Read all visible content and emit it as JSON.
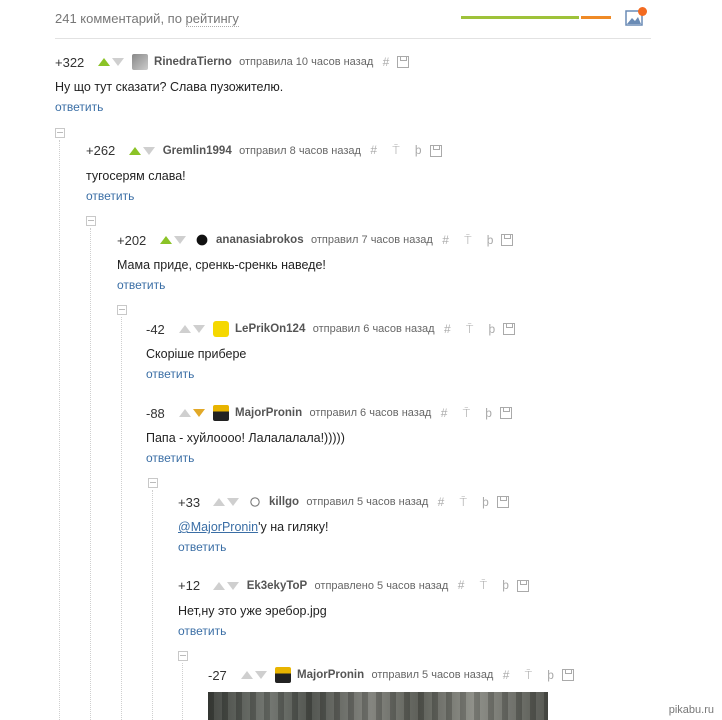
{
  "header": {
    "count_label": "241 комментарий, по ",
    "sort_label": "рейтингу",
    "colors": {
      "accent_green": "#9ec23a",
      "accent_orange": "#ef8a26"
    },
    "icons": [
      "image-icon",
      "notification-dot"
    ]
  },
  "reply_label": "ответить",
  "comments": [
    {
      "rating": "+322",
      "nick": "RinedraTierno",
      "meta": "отправила 10 часов назад",
      "text": "Ну що тут сказати? Слава пузожителю.",
      "vote": "up"
    },
    {
      "rating": "+262",
      "nick": "Gremlin1994",
      "meta": "отправил 8 часов назад",
      "text": "тугосерям слава!",
      "vote": "up"
    },
    {
      "rating": "+202",
      "nick": "ananasiabrokos",
      "meta": "отправил 7 часов назад",
      "text": "Мама приде, сренкь-сренкь наведе!",
      "vote": "up"
    },
    {
      "rating": "-42",
      "nick": "LePrikOn124",
      "meta": "отправил 6 часов назад",
      "text": "Скоріше прибере",
      "vote": "none"
    },
    {
      "rating": "-88",
      "nick": "MajorPronin",
      "meta": "отправил 6 часов назад",
      "text": "Папа - хуйлоооо! Лалалалала!)))))",
      "vote": "down"
    },
    {
      "rating": "+33",
      "nick": "killgo",
      "meta": "отправил 5 часов назад",
      "mention": "@MajorPronin",
      "text": "'у на гиляку!",
      "vote": "none"
    },
    {
      "rating": "+12",
      "nick": "Ek3ekyToP",
      "meta": "отправлено 5 часов назад",
      "text": "Нет,ну это уже эребор.jpg",
      "vote": "none"
    },
    {
      "rating": "-27",
      "nick": "MajorPronin",
      "meta": "отправил 5 часов назад",
      "vote": "none"
    }
  ],
  "tools_glyphs": "# ⍑ ϸ",
  "watermark": "pikabu.ru"
}
